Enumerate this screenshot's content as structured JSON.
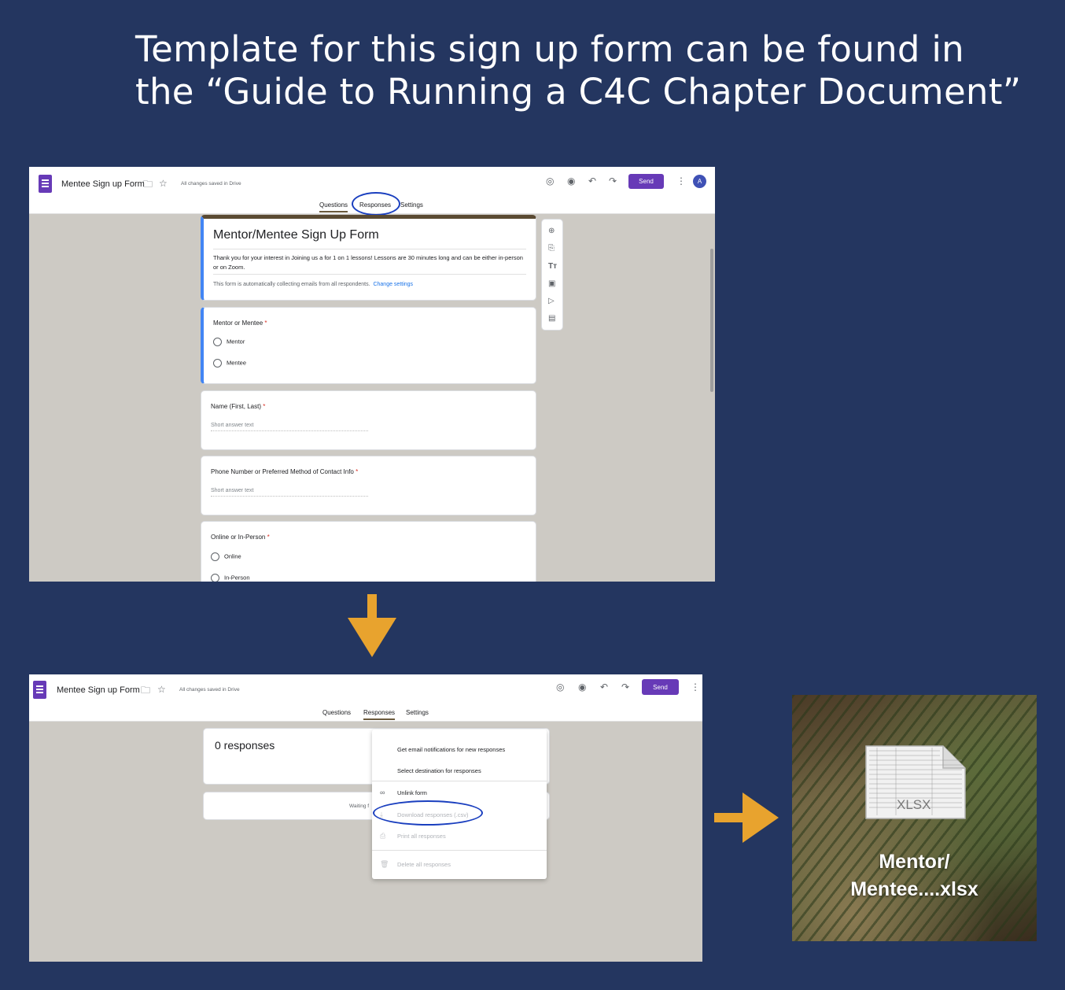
{
  "headline": {
    "line1": "Template for this sign up form can be found in",
    "line2": "the “Guide to Running a C4C Chapter Document”"
  },
  "editor": {
    "doc_title": "Mentee Sign up Form",
    "saved_status": "All changes saved in Drive",
    "send_label": "Send",
    "avatar_initial": "A",
    "tabs": [
      "Questions",
      "Responses",
      "Settings"
    ]
  },
  "form": {
    "title": "Mentor/Mentee Sign Up Form",
    "description": "Thank you for your interest in Joining us a for 1 on 1 lessons!  Lessons are 30 minutes long and can be either in-person or on Zoom.",
    "collect_note": "This form is automatically collecting emails from all respondents.",
    "change_settings_link": "Change settings",
    "questions": [
      {
        "label": "Mentor or Mentee",
        "required": "*",
        "options": [
          "Mentor",
          "Mentee"
        ]
      },
      {
        "label": "Name (First, Last)",
        "required": "*",
        "placeholder": "Short answer text"
      },
      {
        "label": "Phone Number or Preferred Method of Contact Info",
        "required": "*",
        "placeholder": "Short answer text"
      },
      {
        "label": "Online or In-Person",
        "required": "*",
        "options": [
          "Online",
          "In-Person"
        ]
      }
    ]
  },
  "responses_view": {
    "count_label": "0 responses",
    "waiting_text": "Waiting f",
    "menu_items": [
      {
        "label": "Get email notifications for new responses",
        "icon": "none"
      },
      {
        "label": "Select destination for responses",
        "icon": "none"
      },
      {
        "label": "Unlink form",
        "icon": "unlink-icon"
      },
      {
        "label": "Download responses (.csv)",
        "icon": "download-icon"
      },
      {
        "label": "Print all responses",
        "icon": "print-icon"
      },
      {
        "label": "Delete all responses",
        "icon": "trash-icon"
      }
    ]
  },
  "file": {
    "badge": "XLSX",
    "name_line1": "Mentor/",
    "name_line2": "Mentee....xlsx"
  },
  "colors": {
    "page_bg": "#243660",
    "forms_purple": "#673ab7",
    "arrow_orange": "#e8a32e",
    "highlight_circle": "#1a3fbf"
  }
}
